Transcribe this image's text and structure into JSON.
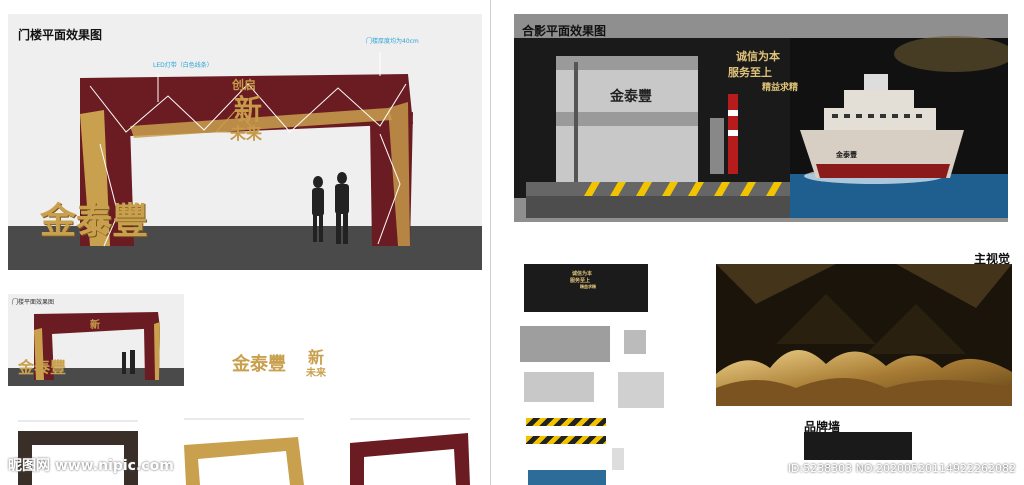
{
  "left_top": {
    "title": "门楼平面效果图",
    "led_label": "LED灯带（白色线条）",
    "thickness_label": "门楼厚度均为40cm",
    "arch_small_top": "创启",
    "arch_big": "新",
    "arch_bottom": "未来",
    "brand": "金泰豐"
  },
  "left_mid": {
    "title": "门楼平面效果图",
    "brand": "金泰豐",
    "arch_big": "新",
    "arch_bottom": "未来"
  },
  "right_top": {
    "title": "合影平面效果图",
    "slogan_1": "诚信为本",
    "slogan_2": "服务至上",
    "slogan_3": "精益求精",
    "tank_brand": "金泰豐",
    "ship_brand": "金泰豐"
  },
  "right_mid": {
    "main_visual_title": "主视觉",
    "brand_wall_title": "品牌墙",
    "mini_slogan_1": "诚信为本",
    "mini_slogan_2": "服务至上",
    "mini_slogan_3": "精益求精"
  },
  "watermark": {
    "left": "昵图网 www.nipic.com",
    "right": "ID:5238303 NO:20200520114922262082"
  },
  "colors": {
    "maroon": "#6b1c22",
    "gold": "#c9a04e",
    "dark_brown": "#3a2f28",
    "ground": "#4a4a4a",
    "sky": "#f0f0f0"
  }
}
